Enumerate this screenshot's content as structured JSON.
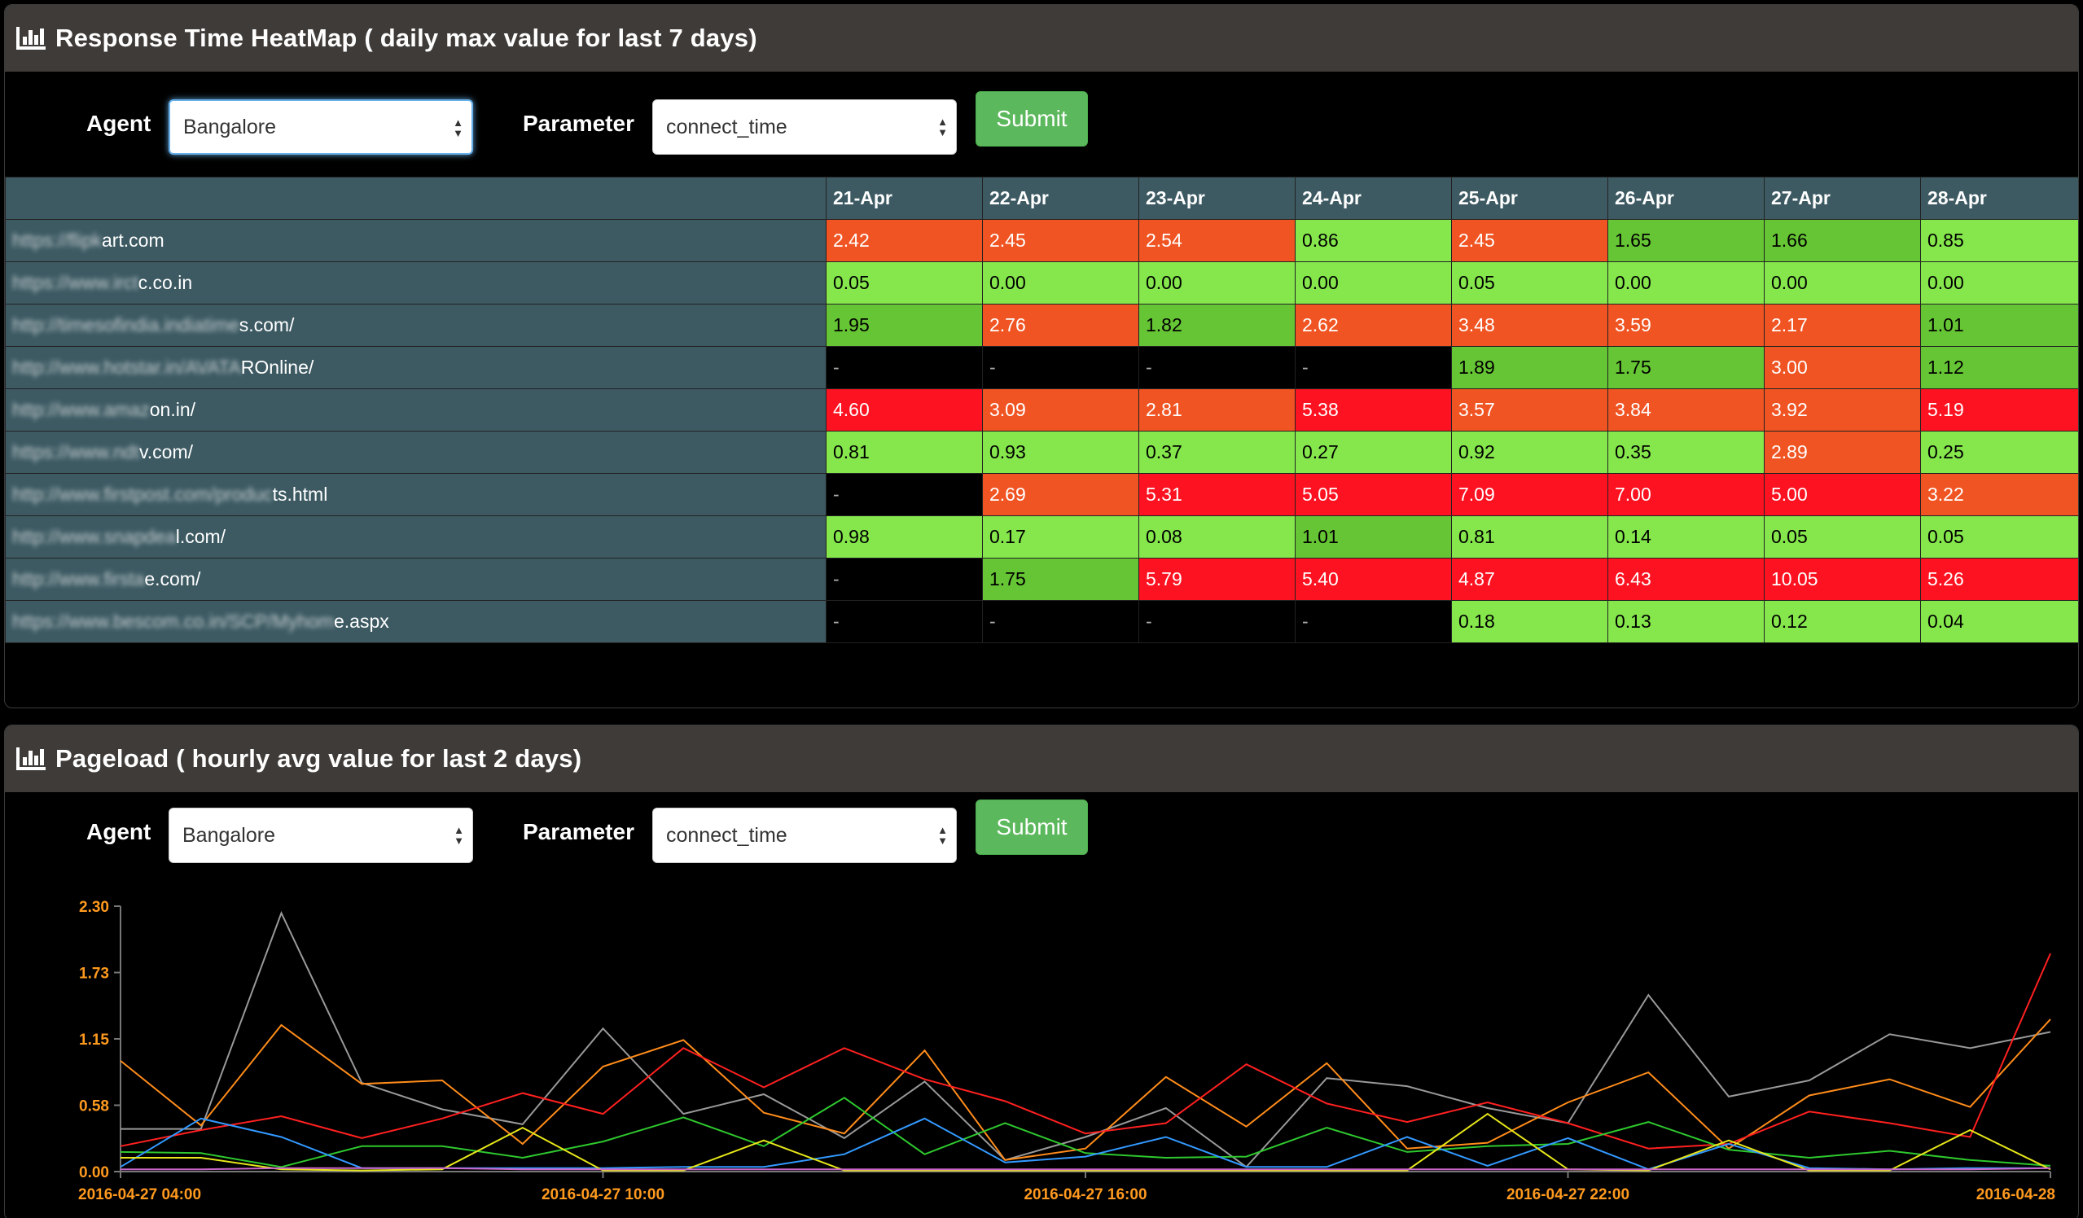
{
  "panel1": {
    "title": "Response Time HeatMap ( daily max value for last 7 days)",
    "icon": "bar-chart-icon",
    "form": {
      "agent_label": "Agent",
      "agent_value": "Bangalore",
      "parameter_label": "Parameter",
      "parameter_value": "connect_time",
      "submit_label": "Submit"
    },
    "heatmap": {
      "columns": [
        "21-Apr",
        "22-Apr",
        "23-Apr",
        "24-Apr",
        "25-Apr",
        "26-Apr",
        "27-Apr",
        "28-Apr"
      ],
      "rows": [
        {
          "url_hidden": "https://flipk",
          "url_visible": "art.com",
          "values": [
            "2.42",
            "2.45",
            "2.54",
            "0.86",
            "2.45",
            "1.65",
            "1.66",
            "0.85"
          ],
          "levels": [
            "or",
            "or",
            "or",
            "lg",
            "or",
            "dg",
            "dg",
            "lg"
          ]
        },
        {
          "url_hidden": "https://www.irct",
          "url_visible": "c.co.in",
          "values": [
            "0.05",
            "0.00",
            "0.00",
            "0.00",
            "0.05",
            "0.00",
            "0.00",
            "0.00"
          ],
          "levels": [
            "lg",
            "lg",
            "lg",
            "lg",
            "lg",
            "lg",
            "lg",
            "lg"
          ]
        },
        {
          "url_hidden": "http://timesofindia.indiatime",
          "url_visible": "s.com/",
          "values": [
            "1.95",
            "2.76",
            "1.82",
            "2.62",
            "3.48",
            "3.59",
            "2.17",
            "1.01"
          ],
          "levels": [
            "dg",
            "or",
            "dg",
            "or",
            "or",
            "or",
            "or",
            "dg"
          ]
        },
        {
          "url_hidden": "http://www.hotstar.in/AVATA",
          "url_visible": "ROnline/",
          "values": [
            "-",
            "-",
            "-",
            "-",
            "1.89",
            "1.75",
            "3.00",
            "1.12"
          ],
          "levels": [
            "e",
            "e",
            "e",
            "e",
            "dg",
            "dg",
            "or",
            "dg"
          ]
        },
        {
          "url_hidden": "http://www.amaz",
          "url_visible": "on.in/",
          "values": [
            "4.60",
            "3.09",
            "2.81",
            "5.38",
            "3.57",
            "3.84",
            "3.92",
            "5.19"
          ],
          "levels": [
            "rd",
            "or",
            "or",
            "rd",
            "or",
            "or",
            "or",
            "rd"
          ]
        },
        {
          "url_hidden": "https://www.ndt",
          "url_visible": "v.com/",
          "values": [
            "0.81",
            "0.93",
            "0.37",
            "0.27",
            "0.92",
            "0.35",
            "2.89",
            "0.25"
          ],
          "levels": [
            "lg",
            "lg",
            "lg",
            "lg",
            "lg",
            "lg",
            "or",
            "lg"
          ]
        },
        {
          "url_hidden": "http://www.firstpost.com/produc",
          "url_visible": "ts.html",
          "values": [
            "-",
            "2.69",
            "5.31",
            "5.05",
            "7.09",
            "7.00",
            "5.00",
            "3.22"
          ],
          "levels": [
            "e",
            "or",
            "rd",
            "rd",
            "rd",
            "rd",
            "rd",
            "or"
          ]
        },
        {
          "url_hidden": "http://www.snapdea",
          "url_visible": "l.com/",
          "values": [
            "0.98",
            "0.17",
            "0.08",
            "1.01",
            "0.81",
            "0.14",
            "0.05",
            "0.05"
          ],
          "levels": [
            "lg",
            "lg",
            "lg",
            "dg",
            "lg",
            "lg",
            "lg",
            "lg"
          ]
        },
        {
          "url_hidden": "http://www.firsta",
          "url_visible": "e.com/",
          "values": [
            "-",
            "1.75",
            "5.79",
            "5.40",
            "4.87",
            "6.43",
            "10.05",
            "5.26"
          ],
          "levels": [
            "e",
            "dg",
            "rd",
            "rd",
            "rd",
            "rd",
            "rd",
            "rd"
          ]
        },
        {
          "url_hidden": "https://www.bescom.co.in/SCP/Myhom",
          "url_visible": "e.aspx",
          "values": [
            "-",
            "-",
            "-",
            "-",
            "0.18",
            "0.13",
            "0.12",
            "0.04"
          ],
          "levels": [
            "e",
            "e",
            "e",
            "e",
            "lg",
            "lg",
            "lg",
            "lg"
          ]
        }
      ],
      "colors": {
        "e": "#000000",
        "lg": "#85e74c",
        "dg": "#66c534",
        "or": "#f05422",
        "rd": "#fc1220"
      }
    }
  },
  "panel2": {
    "title": "Pageload ( hourly avg value for last 2 days)",
    "icon": "bar-chart-icon",
    "form": {
      "agent_label": "Agent",
      "agent_value": "Bangalore",
      "parameter_label": "Parameter",
      "parameter_value": "connect_time",
      "submit_label": "Submit"
    }
  },
  "chart_data": {
    "type": "line",
    "x_ticks": [
      "2016-04-27 04:00",
      "2016-04-27 10:00",
      "2016-04-27 16:00",
      "2016-04-27 22:00",
      "2016-04-28"
    ],
    "y_ticks": [
      "0.00",
      "0.58",
      "1.15",
      "1.73",
      "2.30"
    ],
    "ylim": [
      0,
      2.3
    ],
    "x_hours": [
      0,
      24
    ],
    "grid": false,
    "series": [
      {
        "color": "#999999",
        "values": [
          0.37,
          0.37,
          2.24,
          0.77,
          0.54,
          0.41,
          1.24,
          0.5,
          0.67,
          0.29,
          0.78,
          0.1,
          0.3,
          0.55,
          0.04,
          0.81,
          0.74,
          0.55,
          0.42,
          1.53,
          0.65,
          0.79,
          1.19,
          1.07,
          1.21
        ]
      },
      {
        "color": "#ff8c1a",
        "values": [
          0.96,
          0.4,
          1.27,
          0.76,
          0.79,
          0.24,
          0.91,
          1.14,
          0.51,
          0.33,
          1.05,
          0.1,
          0.2,
          0.82,
          0.39,
          0.94,
          0.2,
          0.25,
          0.6,
          0.86,
          0.2,
          0.66,
          0.8,
          0.56,
          1.32
        ]
      },
      {
        "color": "#ff2020",
        "values": [
          0.22,
          0.36,
          0.48,
          0.29,
          0.46,
          0.68,
          0.5,
          1.07,
          0.73,
          1.07,
          0.8,
          0.61,
          0.33,
          0.42,
          0.93,
          0.59,
          0.43,
          0.6,
          0.42,
          0.2,
          0.24,
          0.52,
          0.42,
          0.3,
          1.89
        ]
      },
      {
        "color": "#2ec82e",
        "values": [
          0.17,
          0.16,
          0.04,
          0.22,
          0.22,
          0.12,
          0.26,
          0.47,
          0.22,
          0.64,
          0.15,
          0.42,
          0.16,
          0.12,
          0.13,
          0.38,
          0.17,
          0.22,
          0.24,
          0.43,
          0.19,
          0.12,
          0.18,
          0.1,
          0.05
        ]
      },
      {
        "color": "#3399ff",
        "values": [
          0.04,
          0.46,
          0.3,
          0.03,
          0.03,
          0.03,
          0.03,
          0.04,
          0.04,
          0.15,
          0.46,
          0.08,
          0.13,
          0.3,
          0.04,
          0.04,
          0.3,
          0.05,
          0.29,
          0.02,
          0.24,
          0.03,
          0.02,
          0.03,
          0.03
        ]
      },
      {
        "color": "#e6e61a",
        "values": [
          0.12,
          0.12,
          0.02,
          0.01,
          0.02,
          0.38,
          0.01,
          0.01,
          0.27,
          0.01,
          0.01,
          0.01,
          0.01,
          0.01,
          0.01,
          0.01,
          0.01,
          0.5,
          0.02,
          0.01,
          0.27,
          0.01,
          0.01,
          0.36,
          0.02
        ]
      },
      {
        "color": "#cc66cc",
        "values": [
          0.02,
          0.02,
          0.03,
          0.03,
          0.03,
          0.02,
          0.02,
          0.02,
          0.02,
          0.02,
          0.02,
          0.02,
          0.02,
          0.02,
          0.02,
          0.02,
          0.02,
          0.02,
          0.02,
          0.02,
          0.02,
          0.02,
          0.02,
          0.02,
          0.03
        ]
      }
    ]
  }
}
